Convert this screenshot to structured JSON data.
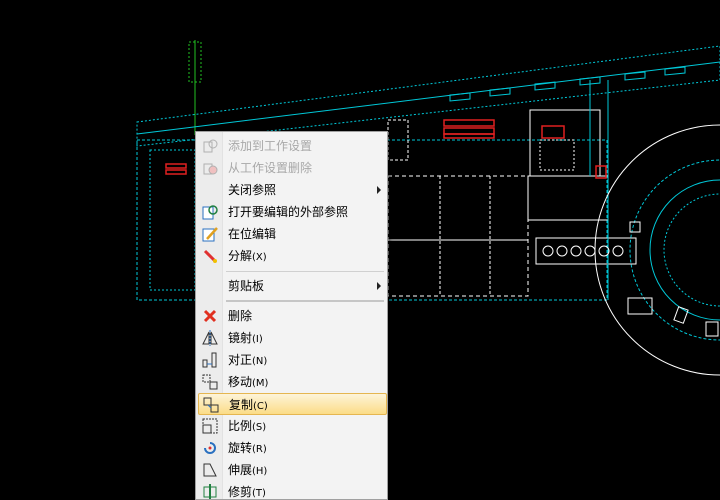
{
  "context_menu": {
    "items": [
      {
        "label": "添加到工作设置",
        "shortcut": "",
        "icon": "xref-add-icon",
        "disabled": true,
        "submenu": false
      },
      {
        "label": "从工作设置删除",
        "shortcut": "",
        "icon": "xref-remove-icon",
        "disabled": true,
        "submenu": false
      },
      {
        "label": "关闭参照",
        "shortcut": "",
        "icon": "",
        "disabled": false,
        "submenu": true
      },
      {
        "label": "打开要编辑的外部参照",
        "shortcut": "",
        "icon": "open-xref-icon",
        "disabled": false,
        "submenu": false
      },
      {
        "label": "在位编辑",
        "shortcut": "",
        "icon": "edit-in-place-icon",
        "disabled": false,
        "submenu": false
      },
      {
        "label": "分解",
        "shortcut": "(X)",
        "icon": "explode-icon",
        "disabled": false,
        "submenu": false
      },
      {
        "label": "剪贴板",
        "shortcut": "",
        "icon": "",
        "disabled": false,
        "submenu": true
      },
      {
        "label": "删除",
        "shortcut": "",
        "icon": "delete-icon",
        "disabled": false,
        "submenu": false
      },
      {
        "label": "镜射",
        "shortcut": "(I)",
        "icon": "mirror-icon",
        "disabled": false,
        "submenu": false
      },
      {
        "label": "对正",
        "shortcut": "(N)",
        "icon": "align-icon",
        "disabled": false,
        "submenu": false
      },
      {
        "label": "移动",
        "shortcut": "(M)",
        "icon": "move-icon",
        "disabled": false,
        "submenu": false
      },
      {
        "label": "复制",
        "shortcut": "(C)",
        "icon": "copy-icon",
        "disabled": false,
        "submenu": false,
        "highlighted": true
      },
      {
        "label": "比例",
        "shortcut": "(S)",
        "icon": "scale-icon",
        "disabled": false,
        "submenu": false
      },
      {
        "label": "旋转",
        "shortcut": "(R)",
        "icon": "rotate-icon",
        "disabled": false,
        "submenu": false
      },
      {
        "label": "伸展",
        "shortcut": "(H)",
        "icon": "stretch-icon",
        "disabled": false,
        "submenu": false
      },
      {
        "label": "修剪",
        "shortcut": "(T)",
        "icon": "trim-icon",
        "disabled": false,
        "submenu": false
      }
    ]
  },
  "colors": {
    "canvas": "#000000",
    "linework": "#00c8d8",
    "walls": "#ffffff",
    "accent_red": "#e02020",
    "highlight": "#fbdc87"
  }
}
